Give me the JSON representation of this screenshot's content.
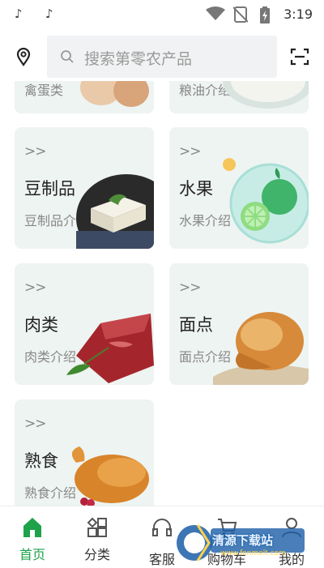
{
  "status_bar": {
    "time": "3:19",
    "app_icons": [
      "tiktok-icon",
      "tiktok-icon"
    ]
  },
  "search": {
    "placeholder": "搜索第零农产品"
  },
  "categories": [
    {
      "arrow": ">>",
      "title": "豆制品",
      "desc": "豆制品介绍",
      "icon": "tofu-image"
    },
    {
      "arrow": ">>",
      "title": "水果",
      "desc": "水果介绍",
      "icon": "fruit-lime-image"
    },
    {
      "arrow": ">>",
      "title": "肉类",
      "desc": "肉类介绍",
      "icon": "meat-image"
    },
    {
      "arrow": ">>",
      "title": "面点",
      "desc": "面点介绍",
      "icon": "bread-image"
    },
    {
      "arrow": ">>",
      "title": "熟食",
      "desc": "熟食介绍",
      "icon": "roast-chicken-image"
    }
  ],
  "partial_cards": [
    {
      "desc": "禽蛋类",
      "icon": "eggs-image"
    },
    {
      "desc": "粮油介绍",
      "icon": "rice-image"
    }
  ],
  "tabs": [
    {
      "label": "首页",
      "icon": "home-icon"
    },
    {
      "label": "分类",
      "icon": "category-icon"
    },
    {
      "label": "客服",
      "icon": "headset-icon"
    },
    {
      "label": "购物车",
      "icon": "cart-icon"
    },
    {
      "label": "我的",
      "icon": "user-icon"
    }
  ],
  "watermark": {
    "text": "清源下载站",
    "sub": "www.fonmelt.com"
  },
  "colors": {
    "accent": "#1ea24a",
    "card_bg": "#eef4f2",
    "search_bg": "#f1f2f3"
  }
}
